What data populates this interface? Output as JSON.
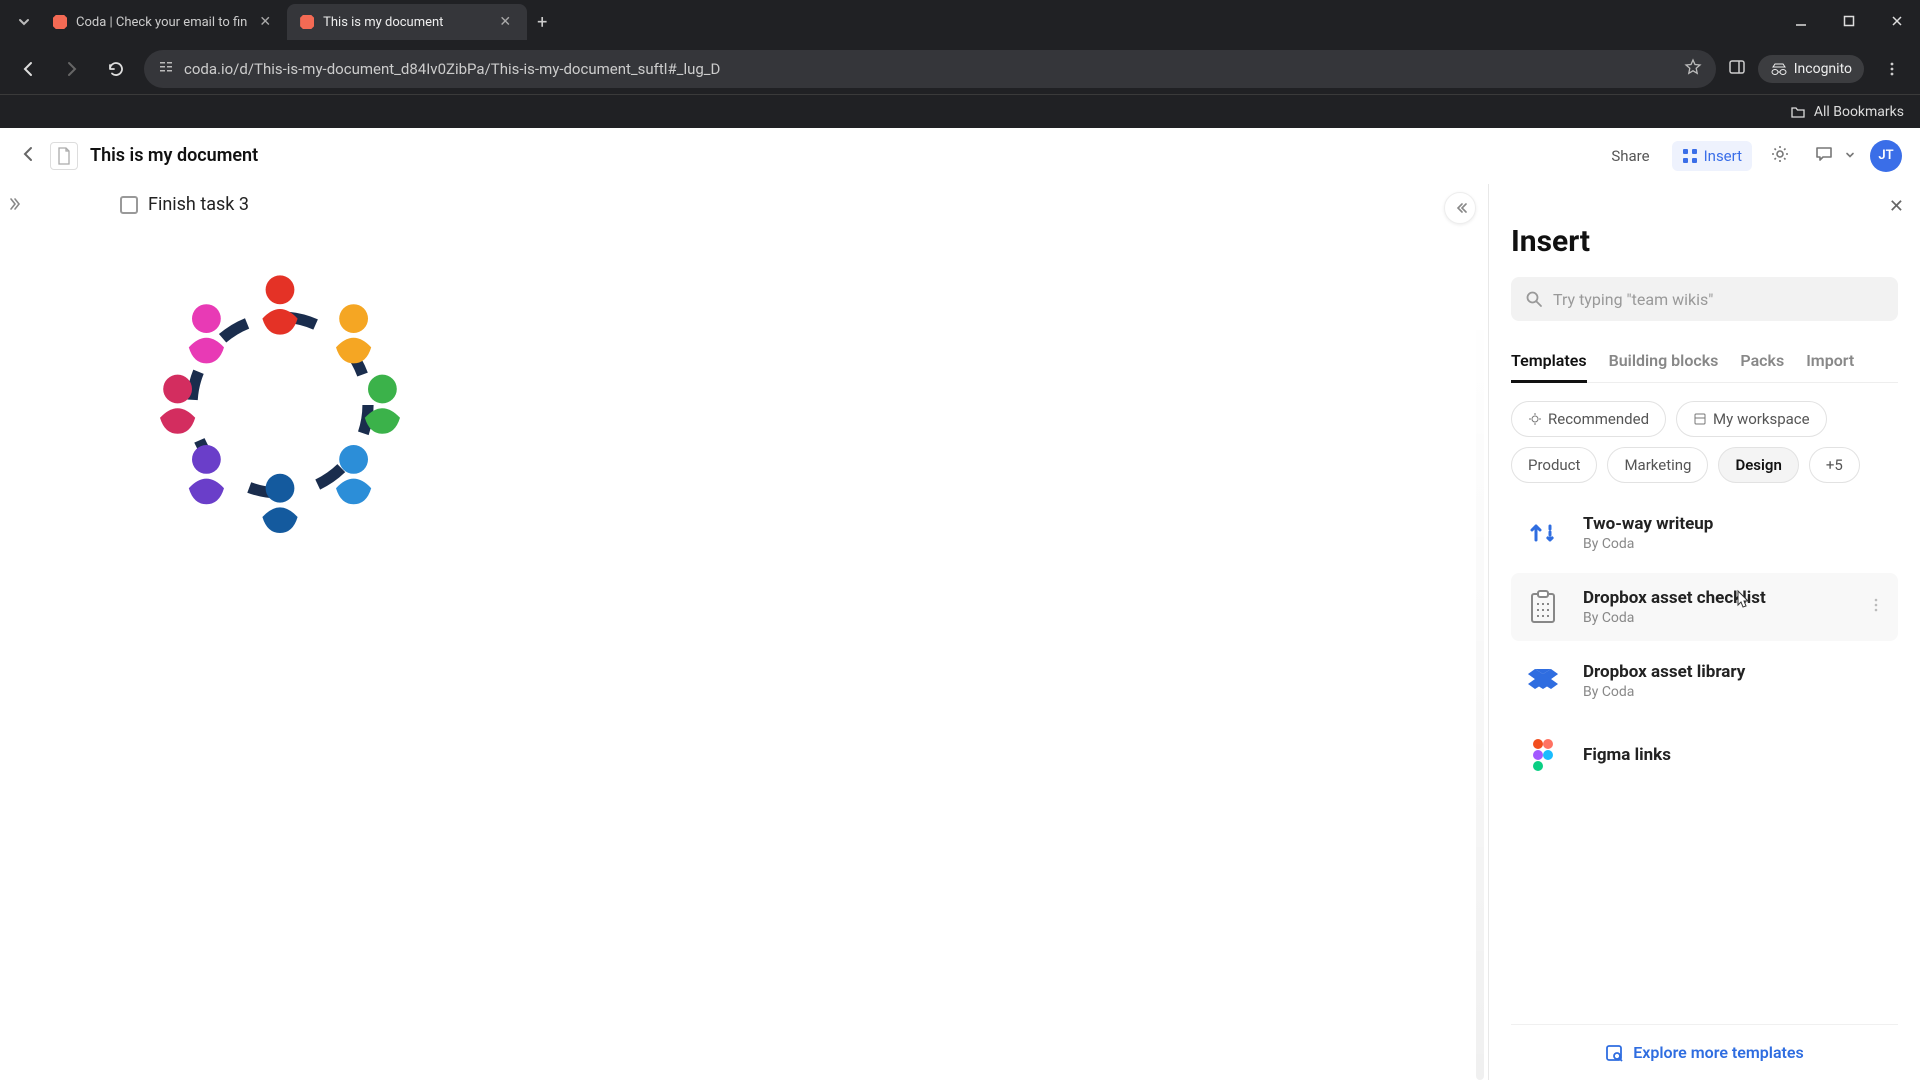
{
  "browser": {
    "tabs": [
      {
        "title": "Coda | Check your email to fin",
        "active": false
      },
      {
        "title": "This is my document",
        "active": true
      }
    ],
    "url": "coda.io/d/This-is-my-document_d84Iv0ZibPa/This-is-my-document_suftl#_lug_D",
    "incognito_label": "Incognito",
    "all_bookmarks": "All Bookmarks"
  },
  "header": {
    "doc_title": "This is my document",
    "share_label": "Share",
    "insert_label": "Insert",
    "avatar_initials": "JT"
  },
  "doc": {
    "task_text": "Finish task 3"
  },
  "panel": {
    "title": "Insert",
    "search_placeholder": "Try typing \"team wikis\"",
    "tabs": [
      "Templates",
      "Building blocks",
      "Packs",
      "Import"
    ],
    "active_tab": "Templates",
    "chips": {
      "recommended": "Recommended",
      "my_workspace": "My workspace",
      "product": "Product",
      "marketing": "Marketing",
      "design": "Design",
      "more": "+5"
    },
    "templates": [
      {
        "title": "Two-way writeup",
        "author": "By Coda",
        "icon": "twoway"
      },
      {
        "title": "Dropbox asset checklist",
        "author": "By Coda",
        "icon": "clipboard",
        "hover": true
      },
      {
        "title": "Dropbox asset library",
        "author": "By Coda",
        "icon": "dropbox"
      },
      {
        "title": "Figma links",
        "author": "",
        "icon": "figma"
      }
    ],
    "explore_label": "Explore more templates"
  }
}
